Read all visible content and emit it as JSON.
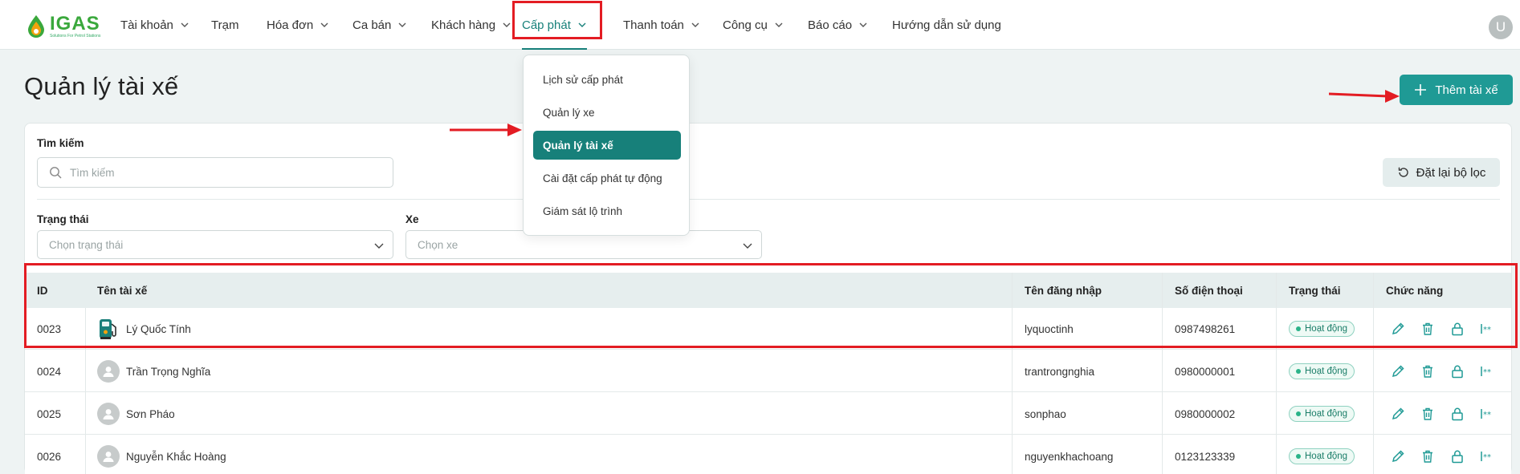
{
  "app": {
    "logo_text": "IGAS",
    "logo_subtitle": "Solutions For Petrol Stations",
    "user_initial": "U"
  },
  "nav": {
    "items": [
      {
        "label": "Tài khoản",
        "has_chevron": true
      },
      {
        "label": "Trạm",
        "has_chevron": false
      },
      {
        "label": "Hóa đơn",
        "has_chevron": true
      },
      {
        "label": "Ca bán",
        "has_chevron": true
      },
      {
        "label": "Khách hàng",
        "has_chevron": true
      },
      {
        "label": "Cấp phát",
        "has_chevron": true,
        "active": true
      },
      {
        "label": "Thanh toán",
        "has_chevron": true
      },
      {
        "label": "Công cụ",
        "has_chevron": true
      },
      {
        "label": "Báo cáo",
        "has_chevron": true
      },
      {
        "label": "Hướng dẫn sử dụng",
        "has_chevron": false
      }
    ]
  },
  "dropdown": {
    "items": [
      {
        "label": "Lịch sử cấp phát"
      },
      {
        "label": "Quản lý xe"
      },
      {
        "label": "Quản lý tài xế",
        "selected": true
      },
      {
        "label": "Cài đặt cấp phát tự động"
      },
      {
        "label": "Giám sát lộ trình"
      }
    ]
  },
  "page": {
    "title": "Quản lý tài xế",
    "add_button": "Thêm tài xế"
  },
  "filters": {
    "search_label": "Tìm kiếm",
    "search_placeholder": "Tìm kiếm",
    "reset_button": "Đặt lại bộ lọc",
    "status_label": "Trạng thái",
    "status_placeholder": "Chọn trạng thái",
    "vehicle_label": "Xe",
    "vehicle_placeholder": "Chọn xe"
  },
  "table": {
    "headers": {
      "id": "ID",
      "name": "Tên tài xế",
      "username": "Tên đăng nhập",
      "phone": "Số điện thoại",
      "status": "Trạng thái",
      "actions": "Chức năng"
    },
    "rows": [
      {
        "id": "0023",
        "name": "Lý Quốc Tính",
        "username": "lyquoctinh",
        "phone": "0987498261",
        "status": "Hoạt động",
        "avatar": "fuel-pump-avatar"
      },
      {
        "id": "0024",
        "name": "Trần Trọng Nghĩa",
        "username": "trantrongnghia",
        "phone": "0980000001",
        "status": "Hoạt động",
        "avatar": "default-avatar"
      },
      {
        "id": "0025",
        "name": "Sơn Pháo",
        "username": "sonphao",
        "phone": "0980000002",
        "status": "Hoạt động",
        "avatar": "default-avatar"
      },
      {
        "id": "0026",
        "name": "Nguyễn Khắc Hoàng",
        "username": "nguyenkhachoang",
        "phone": "0123123339",
        "status": "Hoạt động",
        "avatar": "default-avatar"
      }
    ]
  },
  "colors": {
    "accent": "#17807a",
    "primary_button": "#1f9a95",
    "highlight": "#e31c23",
    "status_active": "#2bb389"
  }
}
